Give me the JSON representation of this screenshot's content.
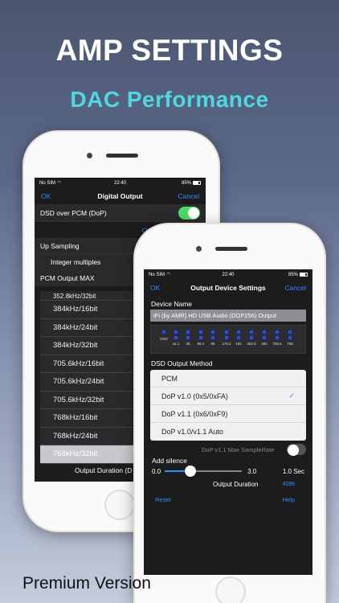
{
  "promo": {
    "headline": "AMP SETTINGS",
    "subheadline": "DAC Performance",
    "footer": "Premium Version"
  },
  "back_screen": {
    "status": {
      "carrier": "No SIM",
      "time": "22:40",
      "battery": "85%"
    },
    "nav": {
      "left": "OK",
      "title": "Digital Output",
      "right": "Cancel"
    },
    "dsd_over_pcm": {
      "label": "DSD over PCM (DoP)",
      "enabled": true
    },
    "change_output_link": "Change the outpu",
    "up_sampling": {
      "label": "Up Sampling",
      "option": "Integer multiples"
    },
    "pcm_output_max": {
      "label": "PCM Output MAX",
      "partial_top": "352.8kHz/32bit",
      "options": [
        "384kHz/16bit",
        "384kHz/24bit",
        "384kHz/32bit",
        "705.6kHz/16bit",
        "705.6kHz/24bit",
        "705.6kHz/32bit",
        "768kHz/16bit",
        "768kHz/24bit",
        "768kHz/32bit"
      ],
      "selected_index": 8
    },
    "output_duration_label": "Output Duration (D"
  },
  "front_screen": {
    "status": {
      "carrier": "No SIM",
      "time": "22:40",
      "battery": "85%"
    },
    "nav": {
      "left": "OK",
      "title": "Output Device Settings",
      "right": "Cancel"
    },
    "device_name": {
      "label": "Device Name",
      "value": "iFi (by AMR) HD USB Audio (DOP256) Output"
    },
    "sample_rates": [
      "DSD",
      "44.1",
      "48",
      "88.2",
      "96",
      "176.4",
      "192",
      "352.8",
      "384",
      "705.6",
      "768"
    ],
    "dsd_output_method": {
      "label": "DSD Output Method",
      "options": [
        "PCM",
        "DoP v1.0 (0x5/0xFA)",
        "DoP v1.1 (0x6/0xF9)",
        "DoP v1.0/v1.1 Auto"
      ],
      "selected_index": 1,
      "check_icon": "✓"
    },
    "dop_max_samplerate": {
      "label": "DoP v1.1 Max SampleRate",
      "enabled": false
    },
    "add_silence": {
      "label": "Add silence",
      "min": "0.0",
      "max": "3.0",
      "value": 1.0,
      "value_label": "1.0",
      "unit": "Sec"
    },
    "output_duration": {
      "label": "Output Duration",
      "value": "4096"
    },
    "reset_label": "Reset",
    "help_label": "Help"
  },
  "colors": {
    "accent": "#2e8cff",
    "toggle_on": "#4cd964",
    "subheadline": "#4fd8e0",
    "rate_indicator": "#1e4fff"
  }
}
